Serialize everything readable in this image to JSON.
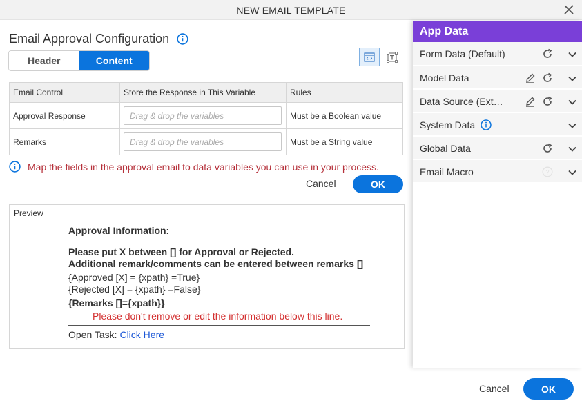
{
  "dialog": {
    "title": "NEW EMAIL TEMPLATE"
  },
  "config": {
    "heading": "Email Approval Configuration",
    "tabs": [
      {
        "label": "Header",
        "active": false
      },
      {
        "label": "Content",
        "active": true
      }
    ],
    "table": {
      "headers": [
        "Email Control",
        "Store the Response in This Variable",
        "Rules"
      ],
      "rows": [
        {
          "control": "Approval Response",
          "placeholder": "Drag & drop the variables",
          "rule": "Must be a Boolean value"
        },
        {
          "control": "Remarks",
          "placeholder": "Drag & drop the variables",
          "rule": "Must be a String value"
        }
      ]
    },
    "hint": "Map the fields in the approval email to data variables you can use in your process.",
    "cancel_label": "Cancel",
    "ok_label": "OK"
  },
  "preview": {
    "label": "Preview",
    "approval_info": "Approval Information:",
    "instruction_1": "Please put X between [] for Approval or Rejected.",
    "instruction_2": "Additional remark/comments can be entered between remarks []",
    "approved_line": "{Approved [X] = {xpath} =True}",
    "rejected_line": "{Rejected [X] = {xpath} =False}",
    "remarks_line": "{Remarks []={xpath}}",
    "warning": "Please don't remove or edit the information below this line.",
    "open_task_prefix": "Open Task: ",
    "open_task_link": "Click Here"
  },
  "app_data": {
    "title": "App Data",
    "items": [
      {
        "label": "Form Data (Default)",
        "icons": [
          "refresh-icon",
          "chevron-down-icon"
        ]
      },
      {
        "label": "Model Data",
        "icons": [
          "edit-icon",
          "refresh-icon",
          "chevron-down-icon"
        ]
      },
      {
        "label": "Data Source (External)",
        "icons": [
          "edit-icon",
          "refresh-icon",
          "chevron-down-icon"
        ]
      },
      {
        "label": "System Data",
        "icons": [
          "info-icon",
          "chevron-down-icon"
        ]
      },
      {
        "label": "Global Data",
        "icons": [
          "refresh-icon",
          "chevron-down-icon"
        ]
      },
      {
        "label": "Email Macro",
        "icons": [
          "help-icon",
          "chevron-down-icon"
        ]
      }
    ]
  },
  "footer": {
    "cancel_label": "Cancel",
    "ok_label": "OK"
  },
  "colors": {
    "primary": "#0b74dd",
    "panel_header": "#7a3fd8",
    "hint_text": "#b5303a",
    "warning_text": "#d32f2f",
    "link": "#1a56d6"
  }
}
